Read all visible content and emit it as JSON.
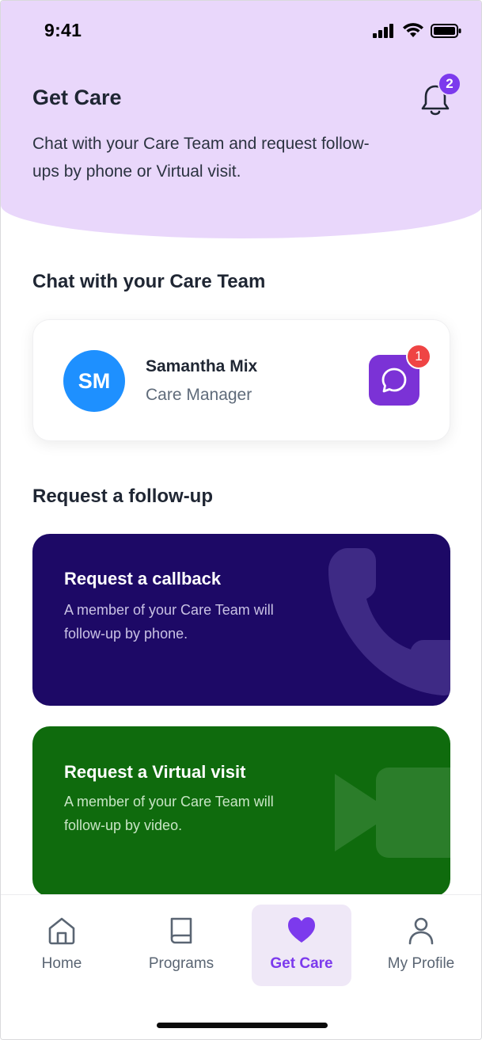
{
  "status_bar": {
    "time": "9:41"
  },
  "header": {
    "title": "Get Care",
    "subtitle": "Chat with your Care Team and request follow-ups by phone or Virtual visit.",
    "notification_count": "2"
  },
  "chat_section": {
    "title": "Chat with your Care Team",
    "contact": {
      "initials": "SM",
      "name": "Samantha Mix",
      "role": "Care Manager",
      "unread_count": "1"
    }
  },
  "followup_section": {
    "title": "Request a follow-up",
    "callback": {
      "title": "Request a callback",
      "description": "A member of your Care Team will follow-up by phone."
    },
    "virtual": {
      "title": "Request a Virtual visit",
      "description": "A member of your Care Team will follow-up by video."
    }
  },
  "bottom_nav": {
    "items": [
      {
        "label": "Home",
        "icon": "home-icon"
      },
      {
        "label": "Programs",
        "icon": "book-icon"
      },
      {
        "label": "Get Care",
        "icon": "heart-icon"
      },
      {
        "label": "My Profile",
        "icon": "person-icon"
      }
    ],
    "active": "Get Care"
  },
  "colors": {
    "hero_bg": "#e9d7fb",
    "accent": "#7c3aed",
    "callback_card": "#1d0966",
    "virtual_card": "#0f6b0d",
    "avatar": "#1e90ff",
    "badge_red": "#ef4444"
  }
}
